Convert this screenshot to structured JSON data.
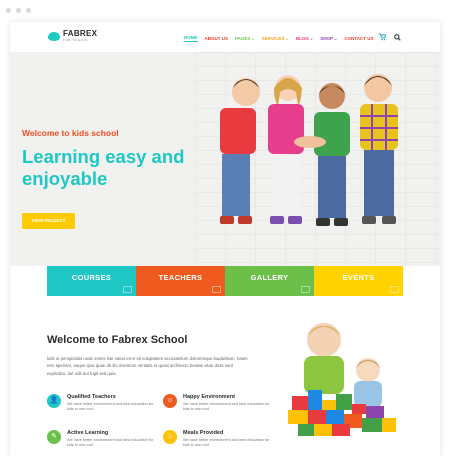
{
  "brand": {
    "name": "FABREX",
    "tagline": "FOR SCHOOL"
  },
  "nav": {
    "items": [
      {
        "label": "HOME",
        "color": "#1fc7c5",
        "dropdown": false
      },
      {
        "label": "ABOUT US",
        "color": "#e8402b",
        "dropdown": false
      },
      {
        "label": "PAGES",
        "color": "#7ac143",
        "dropdown": true
      },
      {
        "label": "SERVICES",
        "color": "#f5a623",
        "dropdown": true
      },
      {
        "label": "BLOG",
        "color": "#e9407a",
        "dropdown": true
      },
      {
        "label": "SHOP",
        "color": "#8e44ad",
        "dropdown": true
      },
      {
        "label": "CONTACT US",
        "color": "#e8402b",
        "dropdown": false
      }
    ],
    "cart_icon": "cart-icon",
    "search_icon": "search-icon"
  },
  "hero": {
    "subtitle": "Welcome to kids school",
    "title": "Learning easy and enjoyable",
    "button": "VIEW PROJECT"
  },
  "tiles": [
    {
      "label": "COURSES",
      "color": "#1fc7c5"
    },
    {
      "label": "TEACHERS",
      "color": "#ef5a1e"
    },
    {
      "label": "GALLERY",
      "color": "#6cc04a"
    },
    {
      "label": "EVENTS",
      "color": "#ffd200"
    }
  ],
  "welcome": {
    "title": "Welcome to Fabrex School",
    "text": "kids ut perspiciatis unde omnis iste natus error sit voluptatem accusantium doloremque laudantium, totam rem aperiam, eaque ipsa quae ab illo inventore veritatis et quasi architecto beatae vitae dicta sunt explicabo. aut odit aut fugit sed quia.",
    "features": [
      {
        "title": "Qualified Teachers",
        "desc": "We have better environment and best education for kids in one roof.",
        "color": "#1fc7c5",
        "icon": "teacher-icon"
      },
      {
        "title": "Happy Environment",
        "desc": "We have better environment and best education for kids in one roof.",
        "color": "#ef5a1e",
        "icon": "smile-icon"
      },
      {
        "title": "Active Learning",
        "desc": "We have better environment and best education for kids in one roof.",
        "color": "#6cc04a",
        "icon": "learning-icon"
      },
      {
        "title": "Meals Provided",
        "desc": "We have better environment and best education for kids in one roof.",
        "color": "#ffc107",
        "icon": "meal-icon"
      }
    ]
  }
}
